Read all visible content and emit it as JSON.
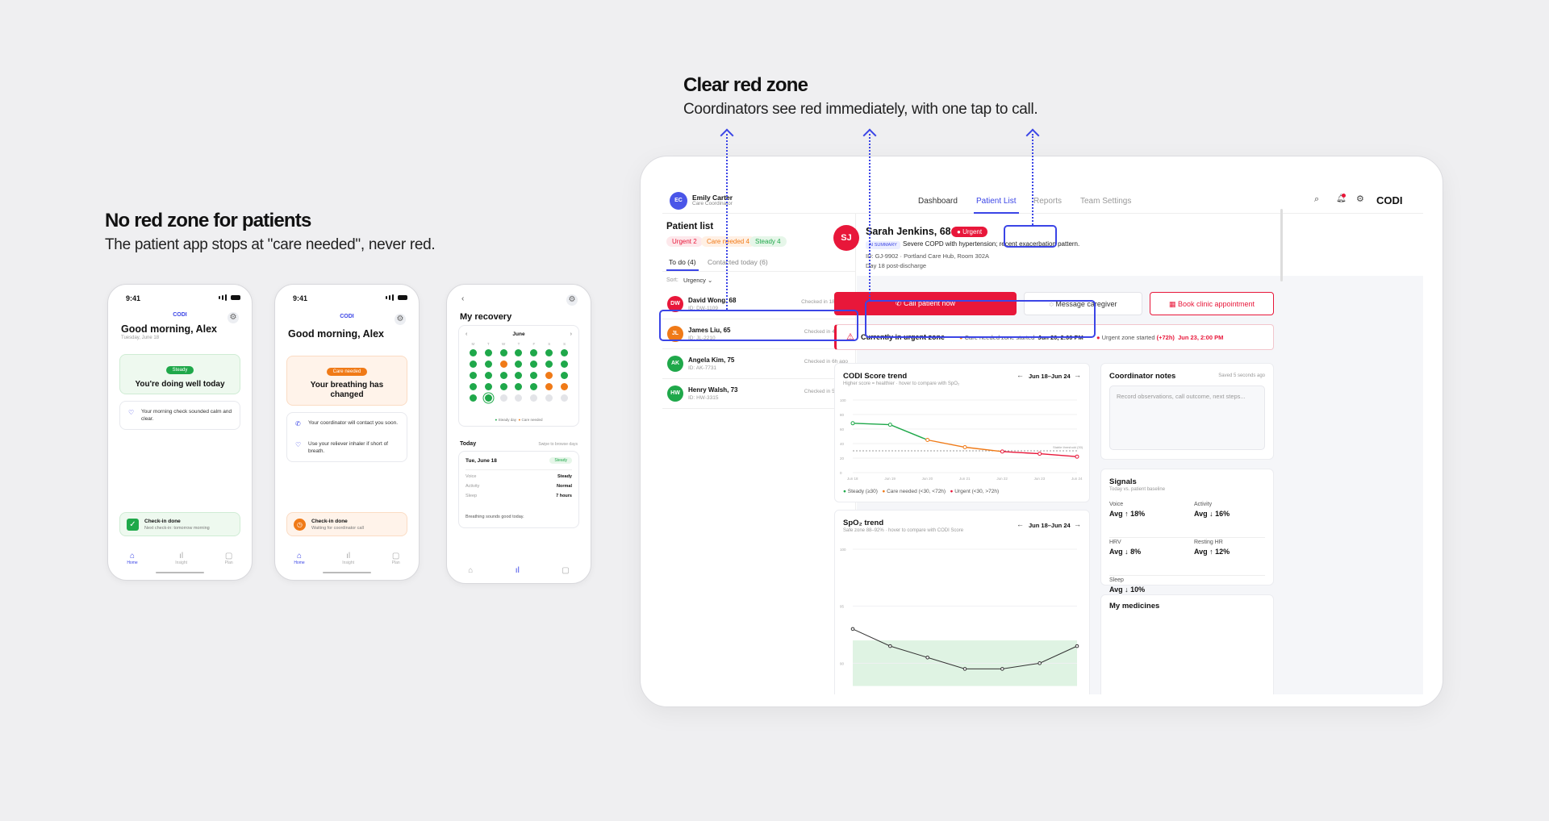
{
  "left_heading": {
    "title": "No red zone for patients",
    "subtitle": "The patient app stops at \"care needed\", never red."
  },
  "right_heading": {
    "title": "Clear red zone",
    "subtitle": "Coordinators see red immediately, with one tap to call."
  },
  "phones": [
    {
      "time": "9:41",
      "brand": "CODI",
      "greeting": "Good morning, Alex",
      "date": "Tuesday, June 18",
      "status_pill": "Steady",
      "status_text": "You're doing well today",
      "messages": [
        "Your morning check sounded calm and clear."
      ],
      "checkin_title": "Check-in done",
      "checkin_sub": "Next check-in: tomorrow morning",
      "tabs": [
        "Home",
        "Insight",
        "Plan"
      ]
    },
    {
      "time": "9:41",
      "brand": "CODI",
      "greeting": "Good morning, Alex",
      "status_pill": "Care needed",
      "status_text": "Your breathing has changed",
      "messages": [
        "Your coordinator will contact you soon.",
        "Use your reliever inhaler if short of breath."
      ],
      "checkin_title": "Check-in done",
      "checkin_sub": "Waiting for coordinator call",
      "tabs": [
        "Home",
        "Insight",
        "Plan"
      ]
    },
    {
      "title": "My recovery",
      "month": "June",
      "weekdays": [
        "M",
        "T",
        "W",
        "T",
        "F",
        "S",
        "S"
      ],
      "legend": [
        "Steady day",
        "Care needed"
      ],
      "today_label": "Today",
      "swipe_hint": "Swipe to browse days",
      "day_title": "Tue, June 18",
      "day_pill": "Steady",
      "rows": [
        {
          "k": "Voice",
          "v": "Steady"
        },
        {
          "k": "Activity",
          "v": "Normal"
        },
        {
          "k": "Sleep",
          "v": "7 hours"
        }
      ],
      "note": "Breathing sounds good today."
    }
  ],
  "calendar_days": [
    "g",
    "g",
    "g",
    "g",
    "g",
    "g",
    "g",
    "g",
    "g",
    "o",
    "g",
    "g",
    "g",
    "g",
    "g",
    "g",
    "g",
    "g",
    "g",
    "o",
    "g",
    "g",
    "g",
    "g",
    "g",
    "g",
    "o",
    "o",
    "g",
    "s",
    "e",
    "e",
    "e",
    "e",
    "e"
  ],
  "dashboard": {
    "user": {
      "initials": "EC",
      "name": "Emily Carter",
      "role": "Care Coordinator"
    },
    "nav": [
      "Dashboard",
      "Patient List",
      "Reports",
      "Team Settings"
    ],
    "brand": "CODI",
    "patient_list": {
      "title": "Patient list",
      "filters": [
        "Urgent 2",
        "Care needed 4",
        "Steady 4"
      ],
      "tabs": [
        "To do (4)",
        "Contacted today (6)"
      ],
      "sort_label": "Sort:",
      "sort_value": "Urgency",
      "patients": [
        {
          "initials": "DW",
          "name": "David Wong, 68",
          "id": "ID: DW-1109",
          "checked": "Checked in 18h ago",
          "color": "#e8173a"
        },
        {
          "initials": "JL",
          "name": "James Liu, 65",
          "id": "ID: JL-2210",
          "checked": "Checked in 4h ago",
          "color": "#f07a17"
        },
        {
          "initials": "AK",
          "name": "Angela Kim, 75",
          "id": "ID: AK-7731",
          "checked": "Checked in 6h ago",
          "color": "#1fa84a"
        },
        {
          "initials": "HW",
          "name": "Henry Walsh, 73",
          "id": "ID: HW-3315",
          "checked": "Checked in 5h ago",
          "color": "#1fa84a"
        }
      ]
    },
    "patient": {
      "initials": "SJ",
      "name": "Sarah Jenkins, 68",
      "badge": "Urgent",
      "ai_label": "AI SUMMARY",
      "summary": "Severe COPD with hypertension; recent exacerbation pattern.",
      "meta1": "ID: GJ-9902 · Portland Care Hub, Room 302A",
      "meta2": "Day 18 post-discharge"
    },
    "actions": {
      "call": "Call patient now",
      "message": "Message caregiver",
      "book": "Book clinic appointment"
    },
    "zone": {
      "title": "Currently in urgent zone",
      "care_label": "Care needed zone started",
      "care_date": "Jun 20, 2:00 PM",
      "urgent_label": "Urgent zone started",
      "urgent_delta": "(+72h)",
      "urgent_date": "Jun 23, 2:00 PM"
    },
    "score_card": {
      "title": "CODI Score trend",
      "subtitle": "Higher score = healthier · hover to compare with SpO₂",
      "range": "Jun 18–Jun 24",
      "threshold_label": "Stable threshold (30)",
      "legend": [
        "Steady (≥30)",
        "Care needed (<30, <72h)",
        "Urgent (<30, >72h)"
      ]
    },
    "spo2_card": {
      "title": "SpO₂ trend",
      "subtitle": "Safe zone 88–92% · hover to compare with CODI Score",
      "range": "Jun 18–Jun 24"
    },
    "notes": {
      "title": "Coordinator notes",
      "saved": "Saved 5 seconds ago",
      "placeholder": "Record observations, call outcome, next steps..."
    },
    "signals": {
      "title": "Signals",
      "subtitle": "Today vs. patient baseline",
      "items": [
        {
          "k": "Voice",
          "v": "Avg ↑ 18%"
        },
        {
          "k": "Activity",
          "v": "Avg ↓ 16%"
        },
        {
          "k": "HRV",
          "v": "Avg ↓ 8%"
        },
        {
          "k": "Resting HR",
          "v": "Avg ↑ 12%"
        },
        {
          "k": "Sleep",
          "v": "Avg ↓ 10%"
        }
      ]
    },
    "medicines_title": "My medicines"
  },
  "chart_data": [
    {
      "type": "line",
      "title": "CODI Score trend",
      "x": [
        "Jun 18",
        "Jun 19",
        "Jun 20",
        "Jun 21",
        "Jun 22",
        "Jun 23",
        "Jun 24"
      ],
      "series": [
        {
          "values": [
            68,
            66,
            45,
            35,
            29,
            26,
            22
          ]
        }
      ],
      "ylim": [
        0,
        100
      ],
      "yticks": [
        0,
        20,
        40,
        60,
        80,
        100
      ],
      "threshold": 30,
      "legend": [
        "Steady (≥30)",
        "Care needed (<30, <72h)",
        "Urgent (<30, >72h)"
      ],
      "colors": {
        "steady": "#1fa84a",
        "care": "#f07a17",
        "urgent": "#e8173a"
      }
    },
    {
      "type": "line",
      "title": "SpO₂ trend",
      "x": [
        "Jun 18",
        "Jun 19",
        "Jun 20",
        "Jun 21",
        "Jun 22",
        "Jun 23",
        "Jun 24"
      ],
      "series": [
        {
          "values": [
            93,
            91.5,
            90.5,
            89.5,
            89.5,
            90,
            91.5
          ]
        }
      ],
      "ylim": [
        85,
        100
      ],
      "yticks": [
        90,
        95,
        100
      ],
      "safe_zone": [
        88,
        92
      ]
    }
  ]
}
